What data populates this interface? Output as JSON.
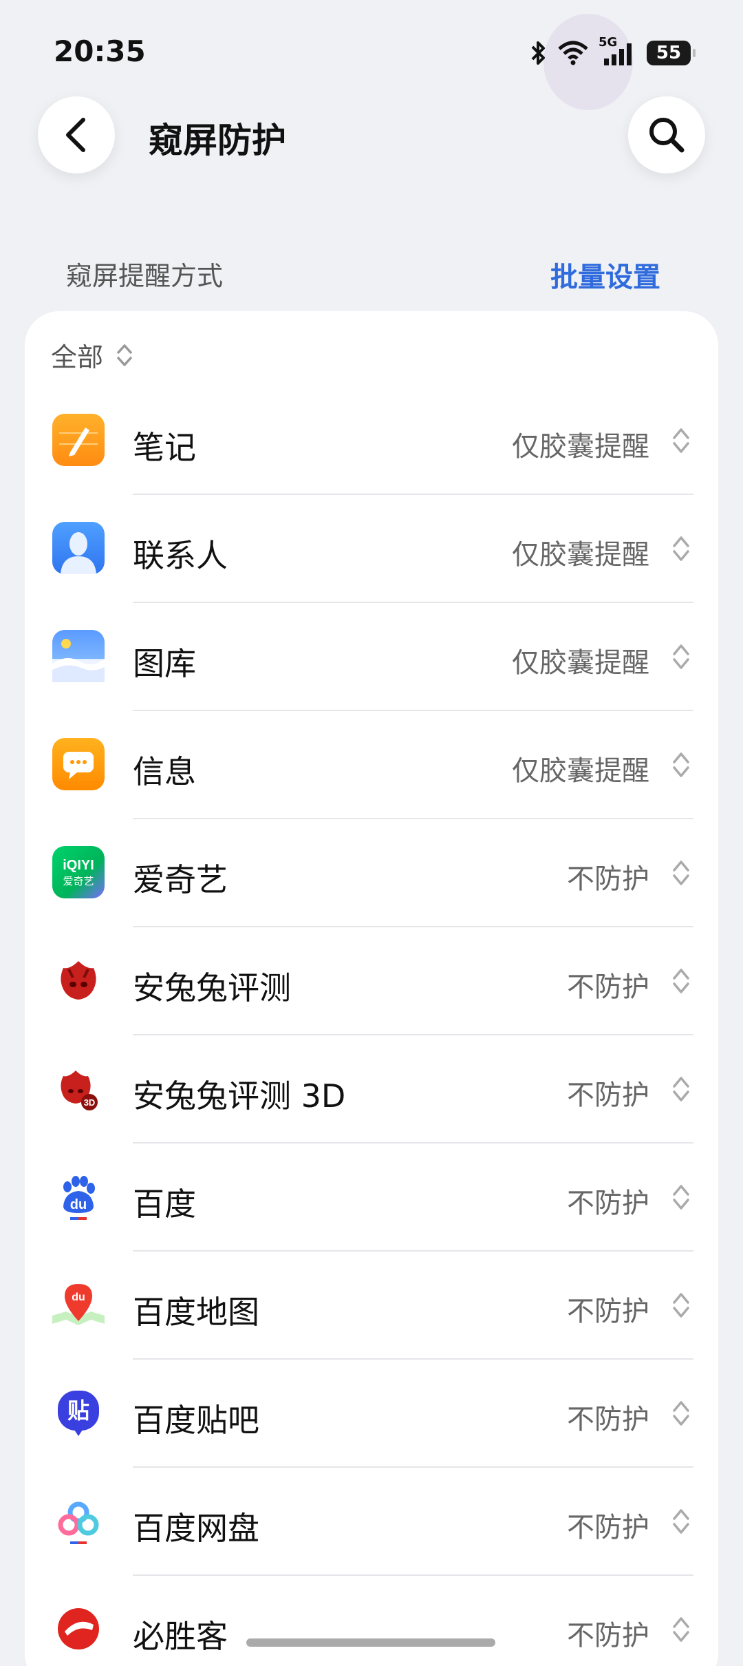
{
  "status": {
    "time": "20:35",
    "battery": "55",
    "network": "5G"
  },
  "header": {
    "title": "窥屏防护",
    "back_icon": "chevron-left-icon",
    "search_icon": "search-icon"
  },
  "section": {
    "label": "窥屏提醒方式",
    "bulk_action": "批量设置"
  },
  "filter": {
    "label": "全部"
  },
  "apps": [
    {
      "name": "笔记",
      "mode": "仅胶囊提醒",
      "icon": "notes-icon"
    },
    {
      "name": "联系人",
      "mode": "仅胶囊提醒",
      "icon": "contacts-icon"
    },
    {
      "name": "图库",
      "mode": "仅胶囊提醒",
      "icon": "gallery-icon"
    },
    {
      "name": "信息",
      "mode": "仅胶囊提醒",
      "icon": "messages-icon"
    },
    {
      "name": "爱奇艺",
      "mode": "不防护",
      "icon": "iqiyi-icon",
      "icon_text": "iQIYI\n爱奇艺"
    },
    {
      "name": "安兔兔评测",
      "mode": "不防护",
      "icon": "antutu-icon"
    },
    {
      "name": "安兔兔评测 3D",
      "mode": "不防护",
      "icon": "antutu-3d-icon",
      "icon_text": "3D"
    },
    {
      "name": "百度",
      "mode": "不防护",
      "icon": "baidu-icon",
      "icon_text": "du"
    },
    {
      "name": "百度地图",
      "mode": "不防护",
      "icon": "baidu-map-icon",
      "icon_text": "du"
    },
    {
      "name": "百度贴吧",
      "mode": "不防护",
      "icon": "baidu-tieba-icon",
      "icon_text": "贴"
    },
    {
      "name": "百度网盘",
      "mode": "不防护",
      "icon": "baidu-netdisk-icon"
    },
    {
      "name": "必胜客",
      "mode": "不防护",
      "icon": "pizza-hut-icon"
    }
  ],
  "colors": {
    "accent": "#2f6bdd",
    "background": "#f0f1f5"
  }
}
